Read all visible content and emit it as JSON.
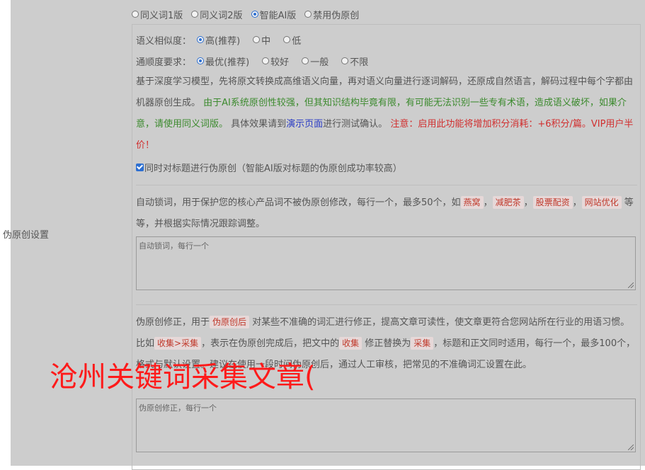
{
  "side_label": "伪原创设置",
  "mode_options": [
    {
      "label": "同义词1版",
      "checked": false
    },
    {
      "label": "同义词2版",
      "checked": false
    },
    {
      "label": "智能AI版",
      "checked": true
    },
    {
      "label": "禁用伪原创",
      "checked": false
    }
  ],
  "similarity": {
    "label": "语义相似度：",
    "options": [
      "高(推荐)",
      "中",
      "低"
    ]
  },
  "fluency": {
    "label": "通顺度要求：",
    "options": [
      "最优(推荐)",
      "较好",
      "一般",
      "不限"
    ]
  },
  "description": {
    "part1": "基于深度学习模型，先将原文转换成高维语义向量，再对语义向量进行逐词解码，还原成自然语言，解码过程中每个字都由机器原创生成。",
    "part2_green": " 由于AI系统原创性较强，但其知识结构毕竟有限，有可能无法识别一些专有术语，造成语义破坏，如果介意，请使用同义词版。",
    "part3": " 具体效果请到",
    "link": "演示页面",
    "part4": "进行测试确认。",
    "part5_red": " 注意：启用此功能将增加积分消耗：+6积分/篇。VIP用户半价！"
  },
  "title_checkbox": {
    "label": "同时对标题进行伪原创（智能AI版对标题的伪原创成功率较高）",
    "checked": true
  },
  "lock_words": {
    "intro": "自动锁词，用于保护您的核心产品词不被伪原创修改，每行一个，最多50个，如",
    "tags": [
      "燕窝",
      "减肥茶",
      "股票配资",
      "网站优化"
    ],
    "sep": "，",
    "outro": " 等等，并根据实际情况跟踪调整。",
    "placeholder": "自动锁词，每行一个"
  },
  "correction": {
    "intro": "伪原创修正，用于",
    "tag1": "伪原创后",
    "mid1": " 对某些不准确的词汇进行修正，提高文章可读性，使文章更符合您网站所在行业的用语习惯。比如",
    "tag2": "收集>采集",
    "mid2": "，表示在伪原创完成后，把文中的",
    "tag3": "收集",
    "mid3": " 修正替换为",
    "tag4": "采集",
    "mid4": "，标题和正文同时适用，每行一个，",
    "hidden": "最多100个，格式与",
    "mid5": "默认设置。建议在使用一段时间伪原创后，通过人工审核，把常见的不准确词汇设置在此。",
    "placeholder": "伪原创修正，每行一个"
  },
  "watermark": "沧州关键词采集文章("
}
